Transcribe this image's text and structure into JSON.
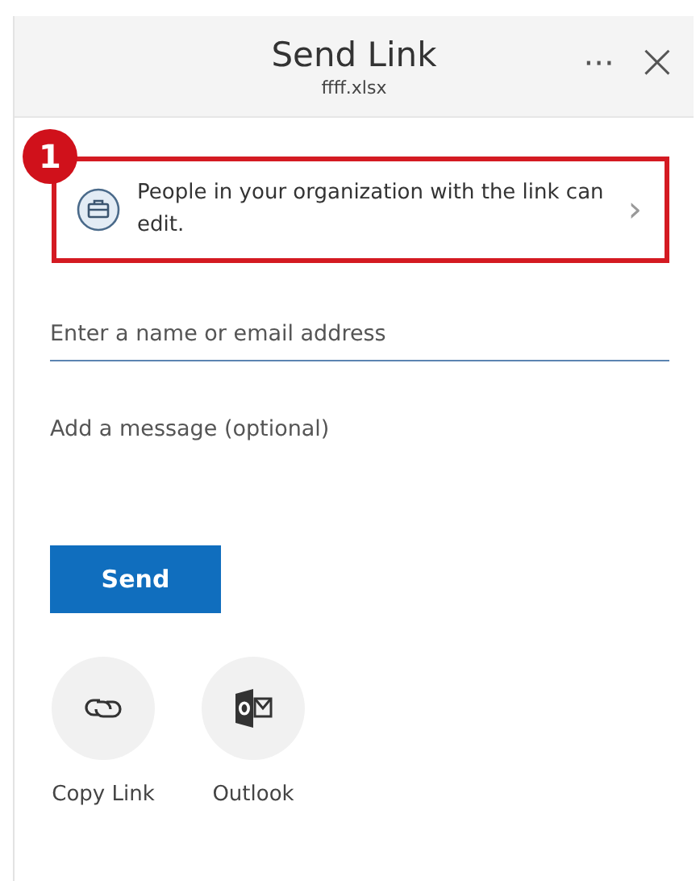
{
  "header": {
    "title": "Send Link",
    "file_name": "ffff.xlsx",
    "more_button": "···",
    "close_button": "×"
  },
  "annotation": {
    "number": "1"
  },
  "link_settings": {
    "text": "People in your organization with the link can edit.",
    "chevron": "›"
  },
  "recipient_field": {
    "placeholder": "Enter a name or email address"
  },
  "message_field": {
    "placeholder": "Add a message (optional)"
  },
  "send_button": "Send",
  "share_options": [
    {
      "kind": "copy-link",
      "label": "Copy Link"
    },
    {
      "kind": "outlook",
      "label": "Outlook"
    }
  ]
}
